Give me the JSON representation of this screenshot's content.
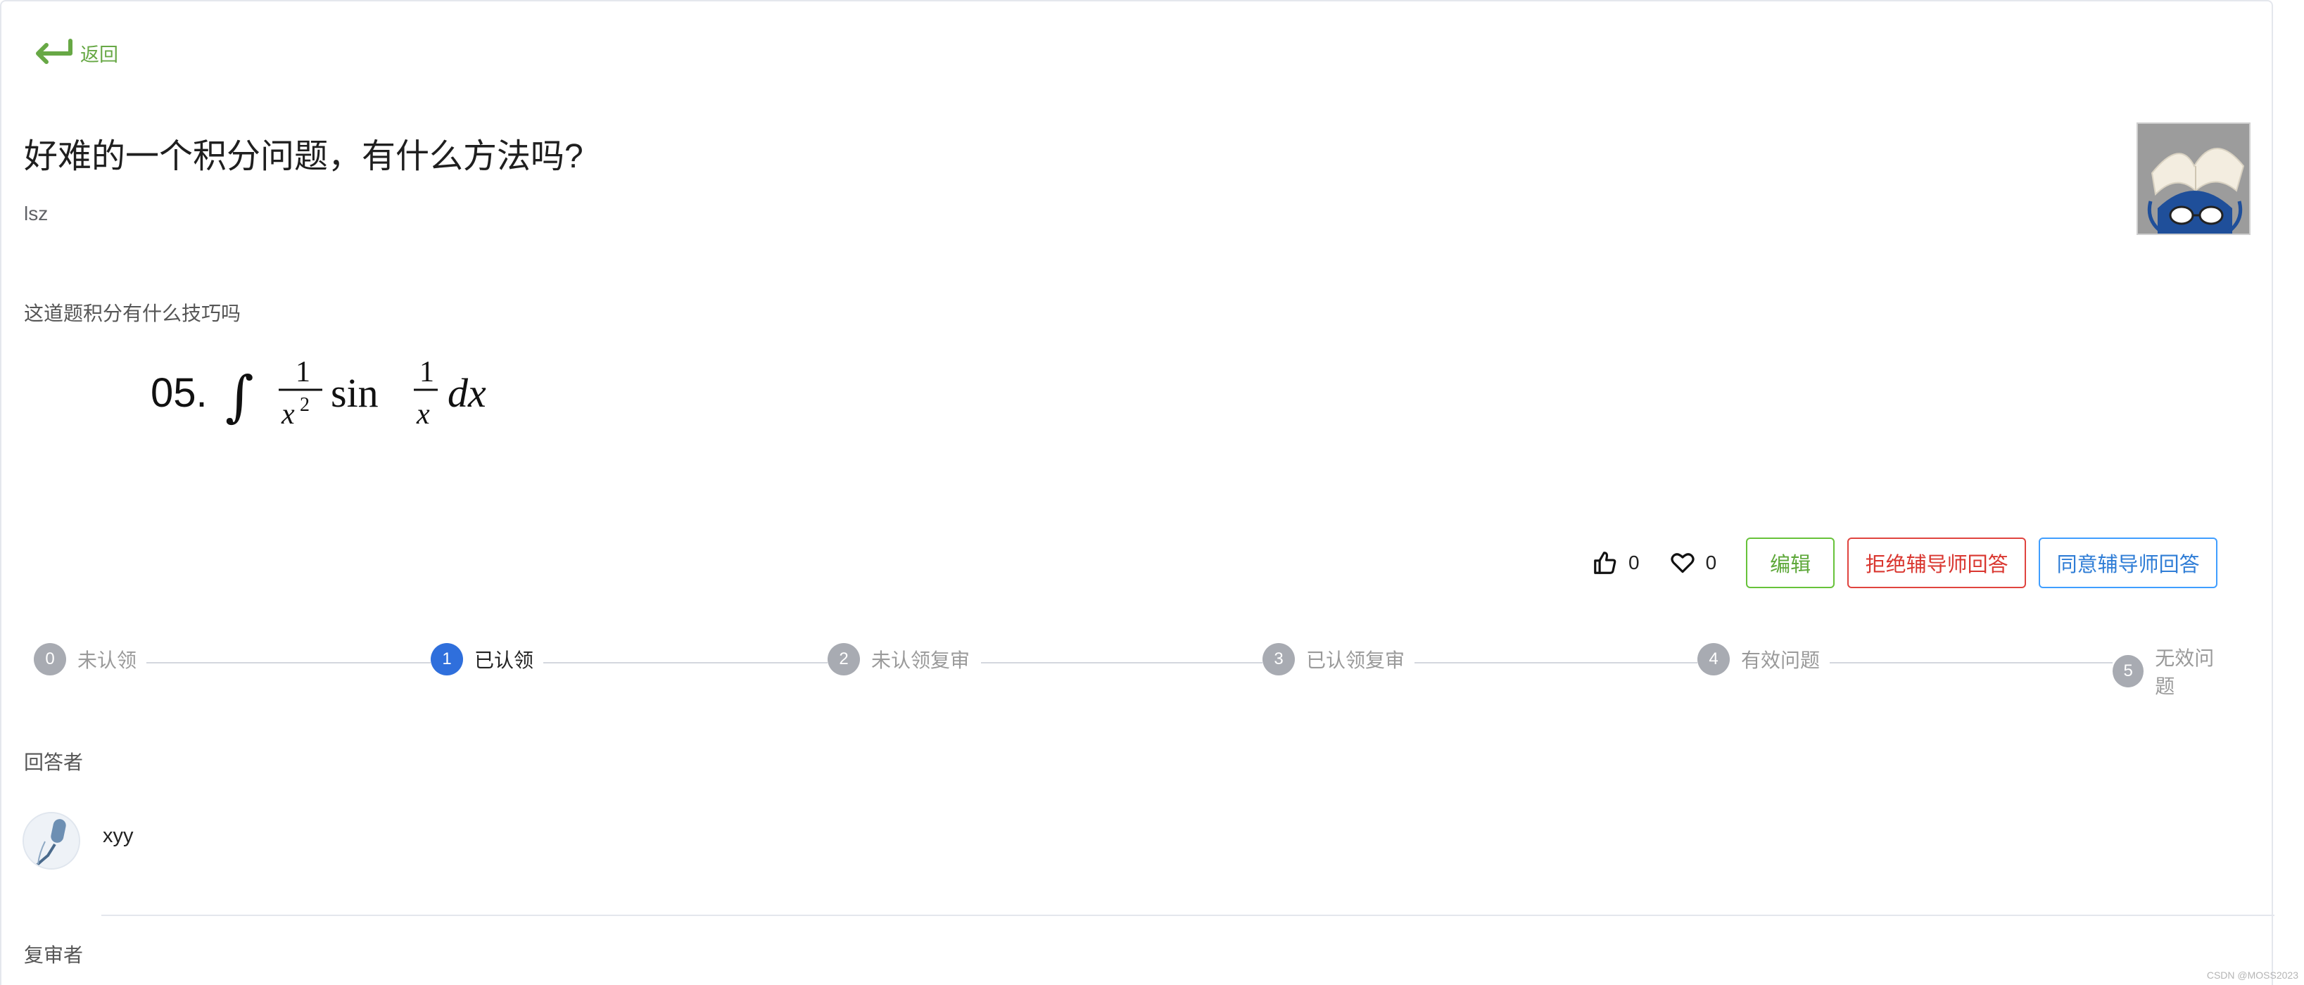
{
  "nav": {
    "back_label": "返回"
  },
  "question": {
    "title": "好难的一个积分问题，有什么方法吗?",
    "author": "lsz",
    "description": "这道题积分有什么技巧吗",
    "formula_prefix": "05."
  },
  "stats": {
    "likes": "0",
    "favorites": "0"
  },
  "buttons": {
    "edit": "编辑",
    "reject": "拒绝辅导师回答",
    "accept": "同意辅导师回答"
  },
  "steps": [
    {
      "num": "0",
      "label": "未认领"
    },
    {
      "num": "1",
      "label": "已认领"
    },
    {
      "num": "2",
      "label": "未认领复审"
    },
    {
      "num": "3",
      "label": "已认领复审"
    },
    {
      "num": "4",
      "label": "有效问题"
    },
    {
      "num": "5",
      "label": "无效问题"
    }
  ],
  "active_step": 1,
  "answerer": {
    "label": "回答者",
    "name": "xyy"
  },
  "reviewer": {
    "label": "复审者"
  },
  "watermark": "CSDN @MOSS2023",
  "colors": {
    "green": "#67c23a",
    "red": "#e0443f",
    "blue": "#409eff",
    "active_step": "#2f6fdc"
  }
}
